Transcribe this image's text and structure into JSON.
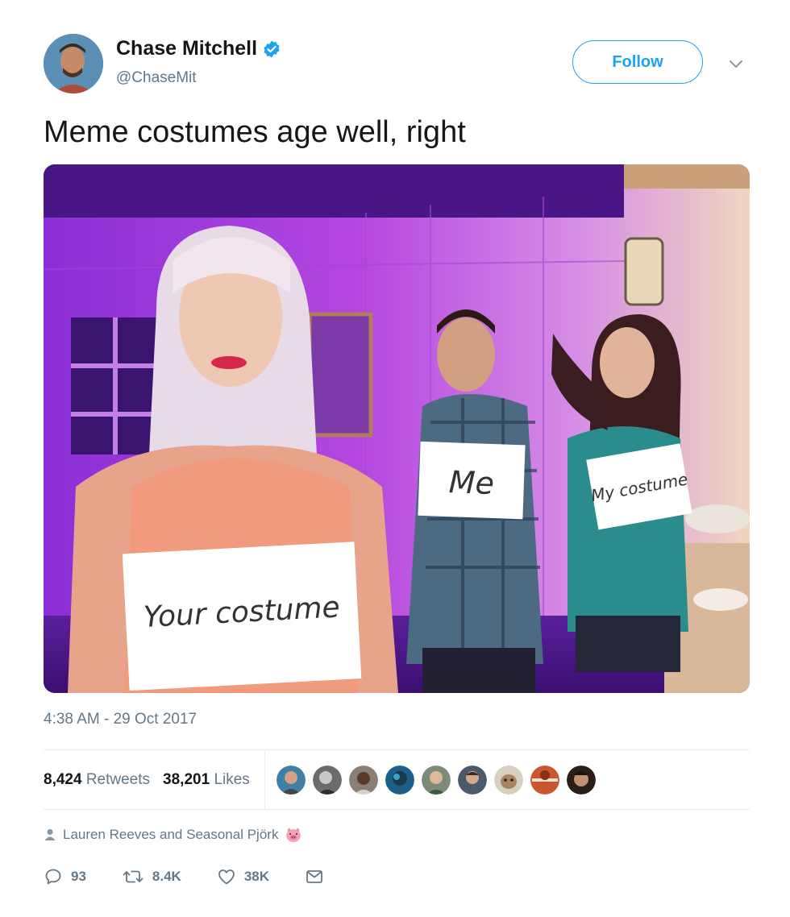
{
  "author": {
    "display_name": "Chase Mitchell",
    "handle": "@ChaseMit",
    "verified": true,
    "avatar_icon": "profile-photo"
  },
  "follow_button": {
    "label": "Follow"
  },
  "menu": {
    "icon": "chevron-down-icon"
  },
  "tweet": {
    "text": "Meme costumes age well, right",
    "timestamp": "4:38 AM - 29 Oct 2017"
  },
  "photo": {
    "signs": [
      "Your costume",
      "Me",
      "My costume"
    ]
  },
  "stats": {
    "retweets_count": "8,424",
    "retweets_label": "Retweets",
    "likes_count": "38,201",
    "likes_label": "Likes",
    "liker_avatars": 9
  },
  "social_context": {
    "text": "Lauren Reeves and Seasonal Pjörk",
    "icon": "person-icon",
    "emoji": "pig-face-icon"
  },
  "actions": {
    "replies": "93",
    "retweets": "8.4K",
    "likes": "38K"
  },
  "colors": {
    "accent": "#1da1f2",
    "verified": "#1da1f2",
    "secondary_text": "#657786",
    "primary_text": "#14171a",
    "divider": "#e6ecf0"
  }
}
